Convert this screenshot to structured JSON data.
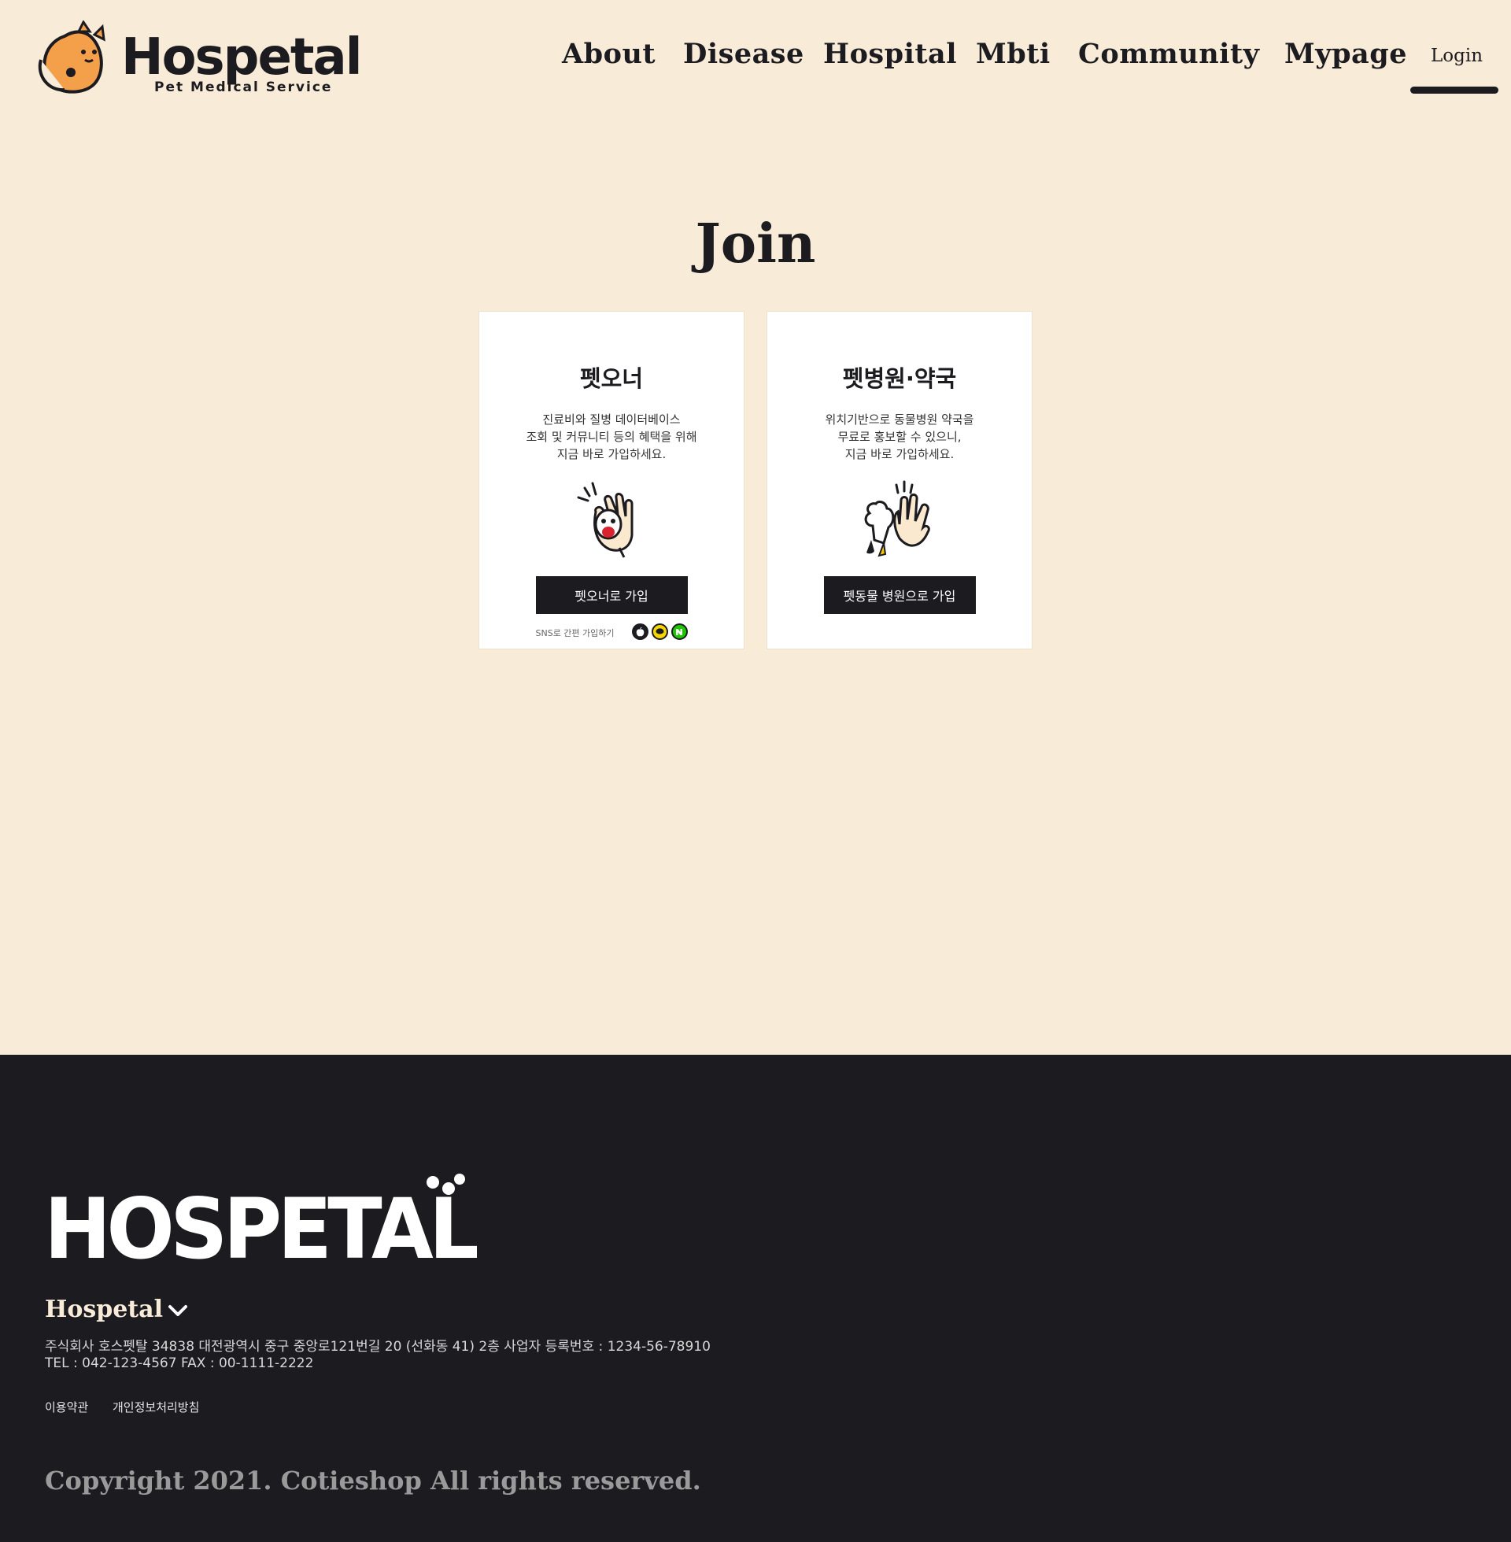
{
  "header": {
    "logo_text": "Hospetal",
    "logo_tagline": "Pet Medical Service",
    "nav": [
      "About",
      "Disease",
      "Hospital",
      "Mbti",
      "Community",
      "Mypage"
    ],
    "login": "Login"
  },
  "join": {
    "title": "Join",
    "cards": [
      {
        "title": "펫오너",
        "desc": [
          "진료비와 질병 데이터베이스",
          "조회 및 커뮤니티 등의 혜택을 위해",
          "지금 바로 가입하세요."
        ],
        "button": "펫오너로 가입",
        "sns_label": "SNS로 간편 가입하기",
        "sns_icons": [
          "apple-icon",
          "kakao-icon",
          "naver-icon"
        ]
      },
      {
        "title": "펫병원·약국",
        "desc": [
          "위치기반으로 동물병원 약국을",
          "무료로 홍보할 수 있으니,",
          "지금 바로 가입하세요."
        ],
        "button": "펫동물 병원으로 가입"
      }
    ]
  },
  "footer": {
    "logo_text": "HOSPETAL",
    "brand": "Hospetal",
    "address": "주식회사 호스펫탈 34838 대전광역시 중구 중앙로121번길 20 (선화동 41) 2층  사업자 등록번호 : 1234-56-78910",
    "contact": "TEL : 042-123-4567 FAX : 00-1111-2222",
    "links": [
      "이용약관",
      "개인정보처리방침"
    ],
    "copyright": "Copyright 2021. Cotieshop All rights reserved."
  },
  "colors": {
    "background": "#f8ebd8",
    "dark": "#1c1b20",
    "accent_orange": "#f4a04a",
    "kakao": "#f7d600",
    "naver": "#1ec800"
  }
}
